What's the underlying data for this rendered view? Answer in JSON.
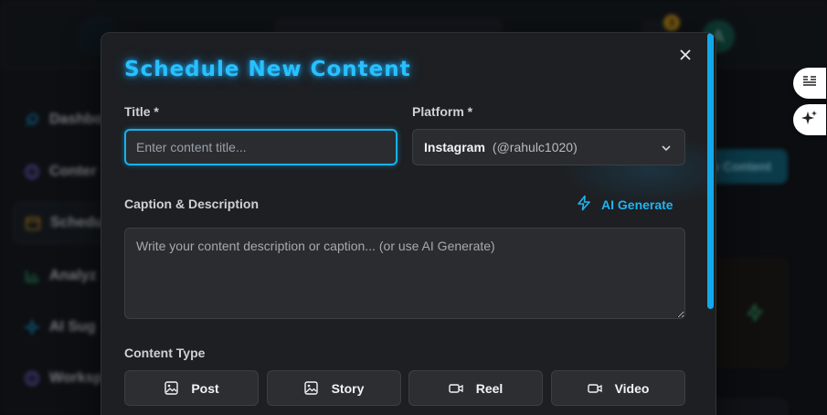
{
  "background": {
    "notification_count": "3",
    "avatar_initial": "A",
    "sidebar_items": [
      {
        "label": "Dashbo",
        "icon": "rocket-icon"
      },
      {
        "label": "Conter",
        "icon": "globe-icon"
      },
      {
        "label": "Schedu",
        "icon": "calendar-icon"
      },
      {
        "label": "Analyz",
        "icon": "bar-chart-icon"
      },
      {
        "label": "AI Sug",
        "icon": "sparkle-icon"
      },
      {
        "label": "Worksp",
        "icon": "globe-icon"
      }
    ],
    "create_button_label": "e Content"
  },
  "modal": {
    "title": "Schedule New Content",
    "title_field": {
      "label": "Title *",
      "placeholder": "Enter content title...",
      "value": ""
    },
    "platform_field": {
      "label": "Platform *",
      "selected_name": "Instagram",
      "selected_handle": "(@rahulc1020)"
    },
    "caption_field": {
      "label": "Caption & Description",
      "placeholder": "Write your content description or caption... (or use AI Generate)",
      "value": ""
    },
    "ai_generate_label": "AI Generate",
    "content_type": {
      "label": "Content Type",
      "options": [
        {
          "label": "Post",
          "icon": "image-icon"
        },
        {
          "label": "Story",
          "icon": "image-icon"
        },
        {
          "label": "Reel",
          "icon": "video-icon"
        },
        {
          "label": "Video",
          "icon": "video-icon"
        }
      ]
    }
  },
  "colors": {
    "accent": "#27c1ff",
    "modal_bg": "#1d1f22",
    "input_bg": "#2a2c30"
  }
}
